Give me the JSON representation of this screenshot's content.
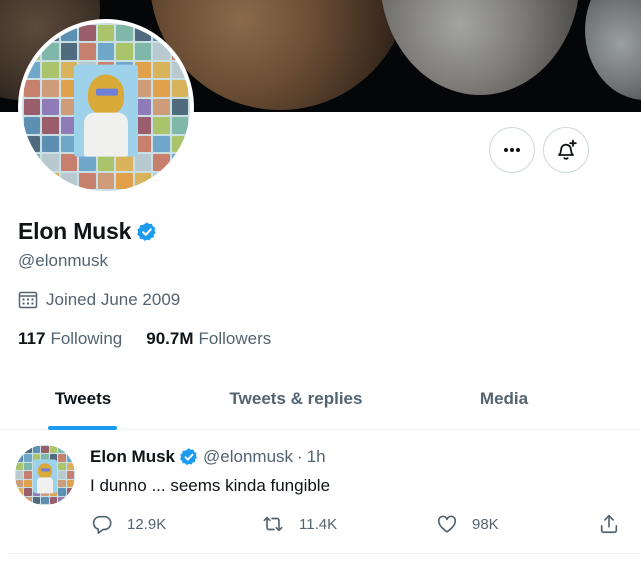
{
  "profile": {
    "display_name": "Elon Musk",
    "handle": "@elonmusk",
    "joined": "Joined June 2009",
    "following_count": "117",
    "following_label": "Following",
    "followers_count": "90.7M",
    "followers_label": "Followers"
  },
  "icons": {
    "more": "more-icon",
    "bell": "notification-bell-icon",
    "verified": "verified-badge-icon",
    "calendar": "calendar-icon",
    "reply": "reply-icon",
    "retweet": "retweet-icon",
    "like": "heart-icon",
    "share": "share-icon"
  },
  "colors": {
    "accent": "#1d9bf0",
    "text_primary": "#0f1419",
    "text_secondary": "#536471",
    "border": "#cfd9de"
  },
  "tabs": [
    {
      "label": "Tweets",
      "active": true
    },
    {
      "label": "Tweets & replies",
      "active": false
    },
    {
      "label": "Media",
      "active": false
    }
  ],
  "tweet": {
    "name": "Elon Musk",
    "handle": "@elonmusk",
    "separator": "·",
    "time": "1h",
    "text": "I dunno ... seems kinda fungible",
    "replies": "12.9K",
    "retweets": "11.4K",
    "likes": "98K"
  }
}
